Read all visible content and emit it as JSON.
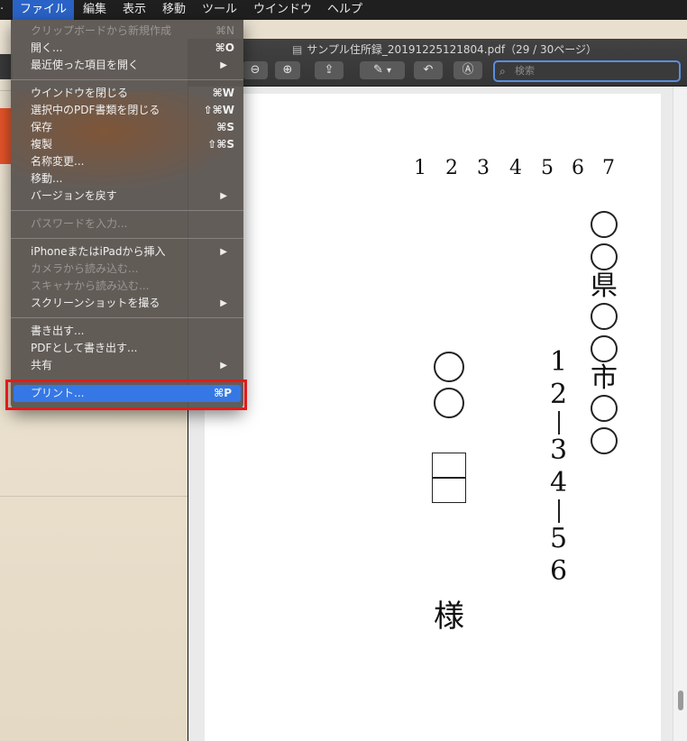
{
  "menubar": {
    "items": [
      "ファイル",
      "編集",
      "表示",
      "移動",
      "ツール",
      "ウインドウ",
      "ヘルプ"
    ]
  },
  "window": {
    "title": "サンプル住所録_20191225121804.pdf（29 / 30ページ）",
    "search_placeholder": "検索"
  },
  "document": {
    "postal_digits": [
      "1",
      "2",
      "3",
      "4",
      "5",
      "6",
      "7"
    ],
    "address_col1": "県",
    "address_col1b": "市",
    "address_number": [
      "1",
      "2",
      "3",
      "4",
      "5",
      "6"
    ],
    "honorific": "様"
  },
  "file_menu": {
    "items": [
      {
        "label": "クリップボードから新規作成",
        "shortcut": "⌘N",
        "disabled": true
      },
      {
        "label": "開く...",
        "shortcut": "⌘O"
      },
      {
        "label": "最近使った項目を開く",
        "submenu": true
      },
      {
        "label": "ウインドウを閉じる",
        "shortcut": "⌘W"
      },
      {
        "label": "選択中のPDF書類を閉じる",
        "shortcut": "⇧⌘W"
      },
      {
        "label": "保存",
        "shortcut": "⌘S"
      },
      {
        "label": "複製",
        "shortcut": "⇧⌘S"
      },
      {
        "label": "名称変更..."
      },
      {
        "label": "移動..."
      },
      {
        "label": "バージョンを戻す",
        "submenu": true
      },
      {
        "label": "パスワードを入力...",
        "disabled": true
      },
      {
        "label": "iPhoneまたはiPadから挿入",
        "submenu": true
      },
      {
        "label": "カメラから読み込む...",
        "disabled": true
      },
      {
        "label": "スキャナから読み込む...",
        "disabled": true
      },
      {
        "label": "スクリーンショットを撮る",
        "submenu": true
      },
      {
        "label": "書き出す..."
      },
      {
        "label": "PDFとして書き出す..."
      },
      {
        "label": "共有",
        "submenu": true
      },
      {
        "label": "プリント...",
        "shortcut": "⌘P",
        "highlighted": true
      }
    ]
  },
  "colors": {
    "highlight": "#3578e5",
    "annotation_box": "#e21b1b",
    "menubar_active": "#2a63c7"
  }
}
